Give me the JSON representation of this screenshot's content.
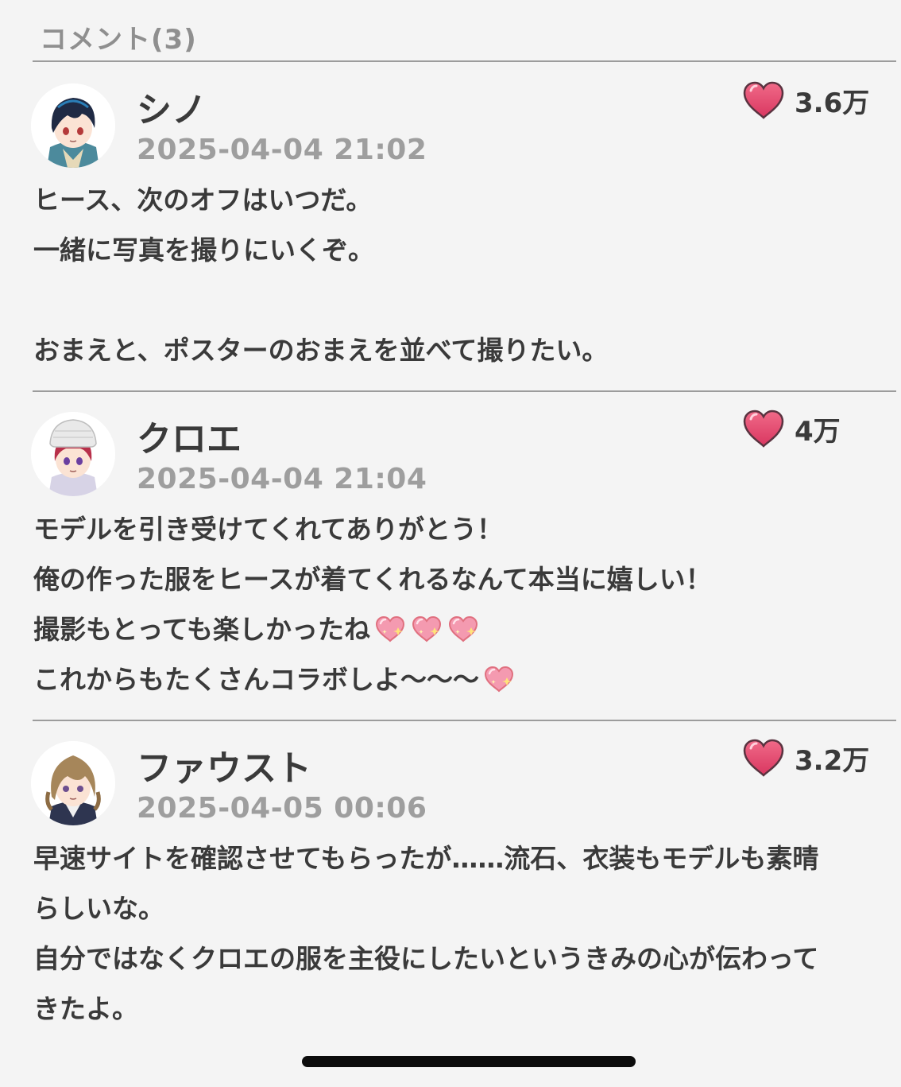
{
  "header": {
    "title": "コメント(3)"
  },
  "comments": [
    {
      "username": "シノ",
      "timestamp": "2025-04-04 21:02",
      "likes": "3.6万",
      "avatar_icon": "avatar-shino",
      "lines": [
        "ヒース、次のオフはいつだ。",
        "一緒に写真を撮りにいくぞ。",
        "",
        "おまえと、ポスターのおまえを並べて撮りたい。"
      ]
    },
    {
      "username": "クロエ",
      "timestamp": "2025-04-04 21:04",
      "likes": "4万",
      "avatar_icon": "avatar-chloe",
      "lines": [
        "モデルを引き受けてくれてありがとう！",
        "俺の作った服をヒースが着てくれるなんて本当に嬉しい！",
        "撮影もとっても楽しかったね",
        "これからもたくさんコラボしよ〜〜〜"
      ]
    },
    {
      "username": "ファウスト",
      "timestamp": "2025-04-05 00:06",
      "likes": "3.2万",
      "avatar_icon": "avatar-faust",
      "lines": [
        "早速サイトを確認させてもらったが……流石、衣装もモデルも素晴",
        "らしいな。",
        "自分ではなくクロエの服を主役にしたいというきみの心が伝わって",
        "きたよ。"
      ]
    }
  ],
  "colors": {
    "background": "#f4f4f4",
    "heart": "#e84a6f",
    "timestamp": "#9e9e9e"
  }
}
